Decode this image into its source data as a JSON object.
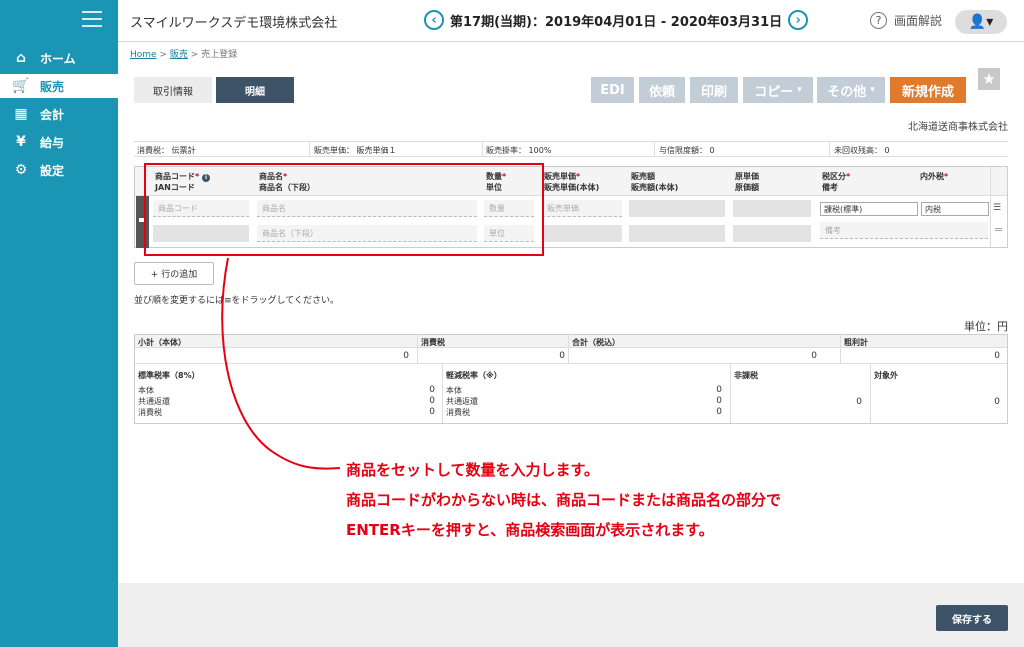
{
  "sidebar": {
    "items": [
      {
        "label": "ホーム",
        "icon": "home-icon",
        "glyph": "⌂"
      },
      {
        "label": "販売",
        "icon": "cart-icon",
        "glyph": "🛒"
      },
      {
        "label": "会計",
        "icon": "calculator-icon",
        "glyph": "▦"
      },
      {
        "label": "給与",
        "icon": "money-bag-icon",
        "glyph": "¥"
      },
      {
        "label": "設定",
        "icon": "gear-icon",
        "glyph": "⚙"
      }
    ]
  },
  "header": {
    "company": "スマイルワークスデモ環境株式会社",
    "prev": "‹",
    "period": "第17期(当期)：2019年04月01日 - 2020年03月31日",
    "next": "›",
    "help_icon": "?",
    "help": "画面解説",
    "user_menu": "👤▾"
  },
  "breadcrumb": {
    "home": "Home",
    "sep1": " > ",
    "sales": "販売",
    "sep2": " > ",
    "current": "売上登録"
  },
  "tabs": {
    "info": "取引情報",
    "detail": "明細"
  },
  "actions": {
    "edi": "EDI",
    "request": "依頼",
    "print": "印刷",
    "copy": "コピー",
    "copy_caret": "▾",
    "other": "その他",
    "other_caret": "▾",
    "new": "新規作成",
    "star": "★"
  },
  "customer": "北海道送商事株式会社",
  "info_row": {
    "tax_label": "消費税：",
    "tax_value": "伝票計",
    "price_label": "販売単価：",
    "price_value": "販売単価１",
    "rate_label": "販売掛率：",
    "rate_value": "100%",
    "credit_label": "与信限度額：",
    "credit_value": "0",
    "unpaid_label": "未回収残高：",
    "unpaid_value": "0"
  },
  "grid": {
    "h_code": "商品コード",
    "h_jan": "JANコード",
    "info_icon": "i",
    "h_name": "商品名",
    "h_name2": "商品名（下段）",
    "h_qty": "数量",
    "h_unit": "単位",
    "h_price": "販売単価",
    "h_price2": "販売単価(本体)",
    "h_amount": "販売額",
    "h_amount2": "販売額(本体)",
    "h_cost": "原単価",
    "h_cost2": "原価額",
    "h_taxcat": "税区分",
    "h_note": "備考",
    "h_taxmode": "内外税",
    "req": "*",
    "ph_code": "商品コード",
    "ph_name": "商品名",
    "ph_name2": "商品名（下段）",
    "ph_qty": "数量",
    "ph_unit": "単位",
    "ph_price": "販売単価",
    "ph_note": "備考",
    "taxcat_value": "課税(標準)",
    "taxmode_value": "内税",
    "menu_glyph": "☰",
    "drag_glyph": "="
  },
  "add_row": "+ 行の追加",
  "drag_hint": "並び順を変更するには≡をドラッグしてください。",
  "unit_label": "単位：円",
  "totals": {
    "subtotal_label": "小計（本体）",
    "subtotal": "0",
    "tax_label": "消費税",
    "tax": "0",
    "total_label": "合計（税込）",
    "total": "0",
    "profit_label": "粗利計",
    "profit": "0",
    "std_label": "標準税率（8%）",
    "std_rows": [
      {
        "k": "本体",
        "v": "0"
      },
      {
        "k": "共通返還",
        "v": "0"
      },
      {
        "k": "消費税",
        "v": "0"
      }
    ],
    "red_label": "軽減税率（※）",
    "red_rows": [
      {
        "k": "本体",
        "v": "0"
      },
      {
        "k": "共通返還",
        "v": "0"
      },
      {
        "k": "消費税",
        "v": "0"
      }
    ],
    "nontax_label": "非課税",
    "nontax": "0",
    "exempt_label": "対象外",
    "exempt": "0"
  },
  "save": "保存する",
  "annotation": [
    "商品をセットして数量を入力します。",
    "商品コードがわからない時は、商品コードまたは商品名の部分で",
    "ENTERキーを押すと、商品検索画面が表示されます。"
  ],
  "colors": {
    "sidebar": "#1a95b4",
    "annotation": "#e60012",
    "new_button": "#e07a2c",
    "dark": "#3d5367"
  }
}
